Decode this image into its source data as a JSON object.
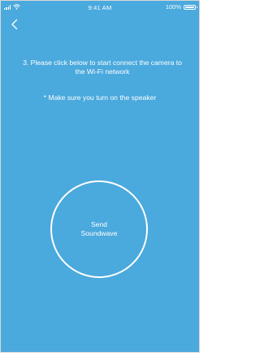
{
  "status_bar": {
    "time": "9:41 AM",
    "battery": "100%",
    "icons": [
      "signal-icon",
      "wifi-icon",
      "battery-icon"
    ]
  },
  "nav": {
    "back_icon": "chevron-left-icon"
  },
  "content": {
    "instruction": "3. Please click below to start connect the camera to the Wi-Fi network",
    "note": "* Make sure you turn on the speaker",
    "button_label": "Send\nSoundwave"
  },
  "colors": {
    "background": "#4aa9dd",
    "foreground": "#ffffff"
  }
}
